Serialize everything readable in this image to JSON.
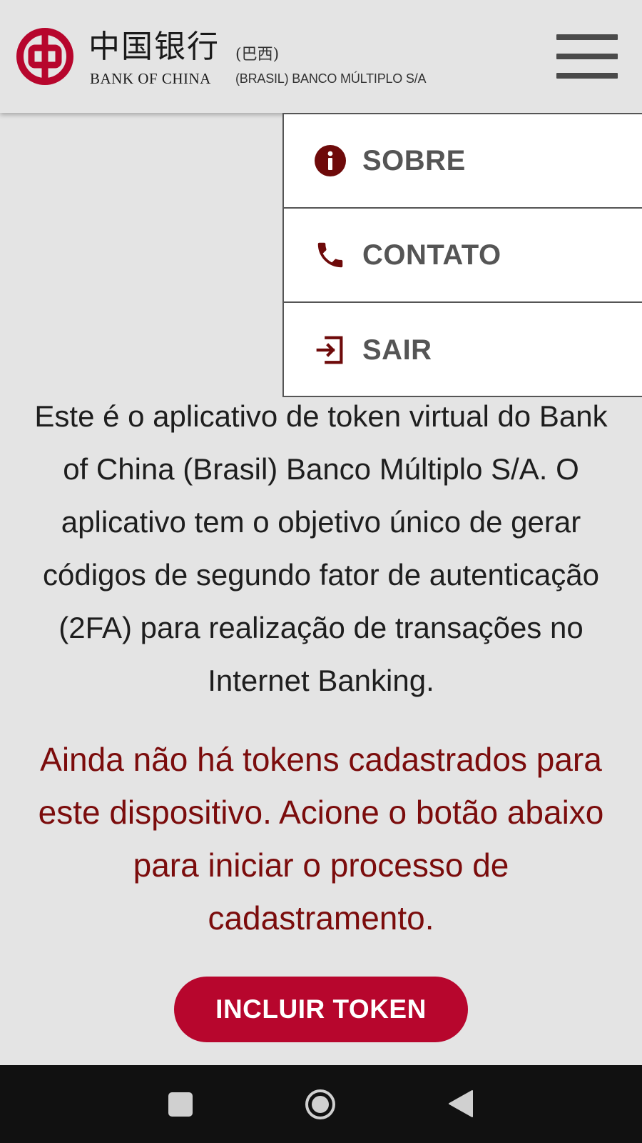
{
  "header": {
    "logo_cn": "中国银行",
    "logo_cn_sub": "(巴西)",
    "logo_en": "BANK OF CHINA",
    "logo_en_sub": "(BRASIL) BANCO MÚLTIPLO S/A",
    "menu_icon": "hamburger-icon"
  },
  "menu": {
    "items": [
      {
        "label": "SOBRE",
        "icon": "info-icon"
      },
      {
        "label": "CONTATO",
        "icon": "phone-icon"
      },
      {
        "label": "SAIR",
        "icon": "logout-icon"
      }
    ]
  },
  "main": {
    "description": "Este é o aplicativo de token virtual do Bank of China (Brasil) Banco Múltiplo S/A. O aplicativo tem o objetivo único de gerar códigos de segundo fator de autenticação (2FA) para realização de transações no Internet Banking.",
    "notice": "Ainda não há tokens cadastrados para este dispositivo. Acione o botão abaixo para iniciar o processo de cadastramento.",
    "include_button": "INCLUIR TOKEN"
  },
  "navbar": {
    "icons": [
      "recent-apps-icon",
      "home-icon",
      "back-icon"
    ]
  },
  "colors": {
    "brand_red": "#b7062d",
    "notice_red": "#7b0c0c",
    "menu_icon_red": "#6e0a0a",
    "background": "#e4e4e4"
  }
}
